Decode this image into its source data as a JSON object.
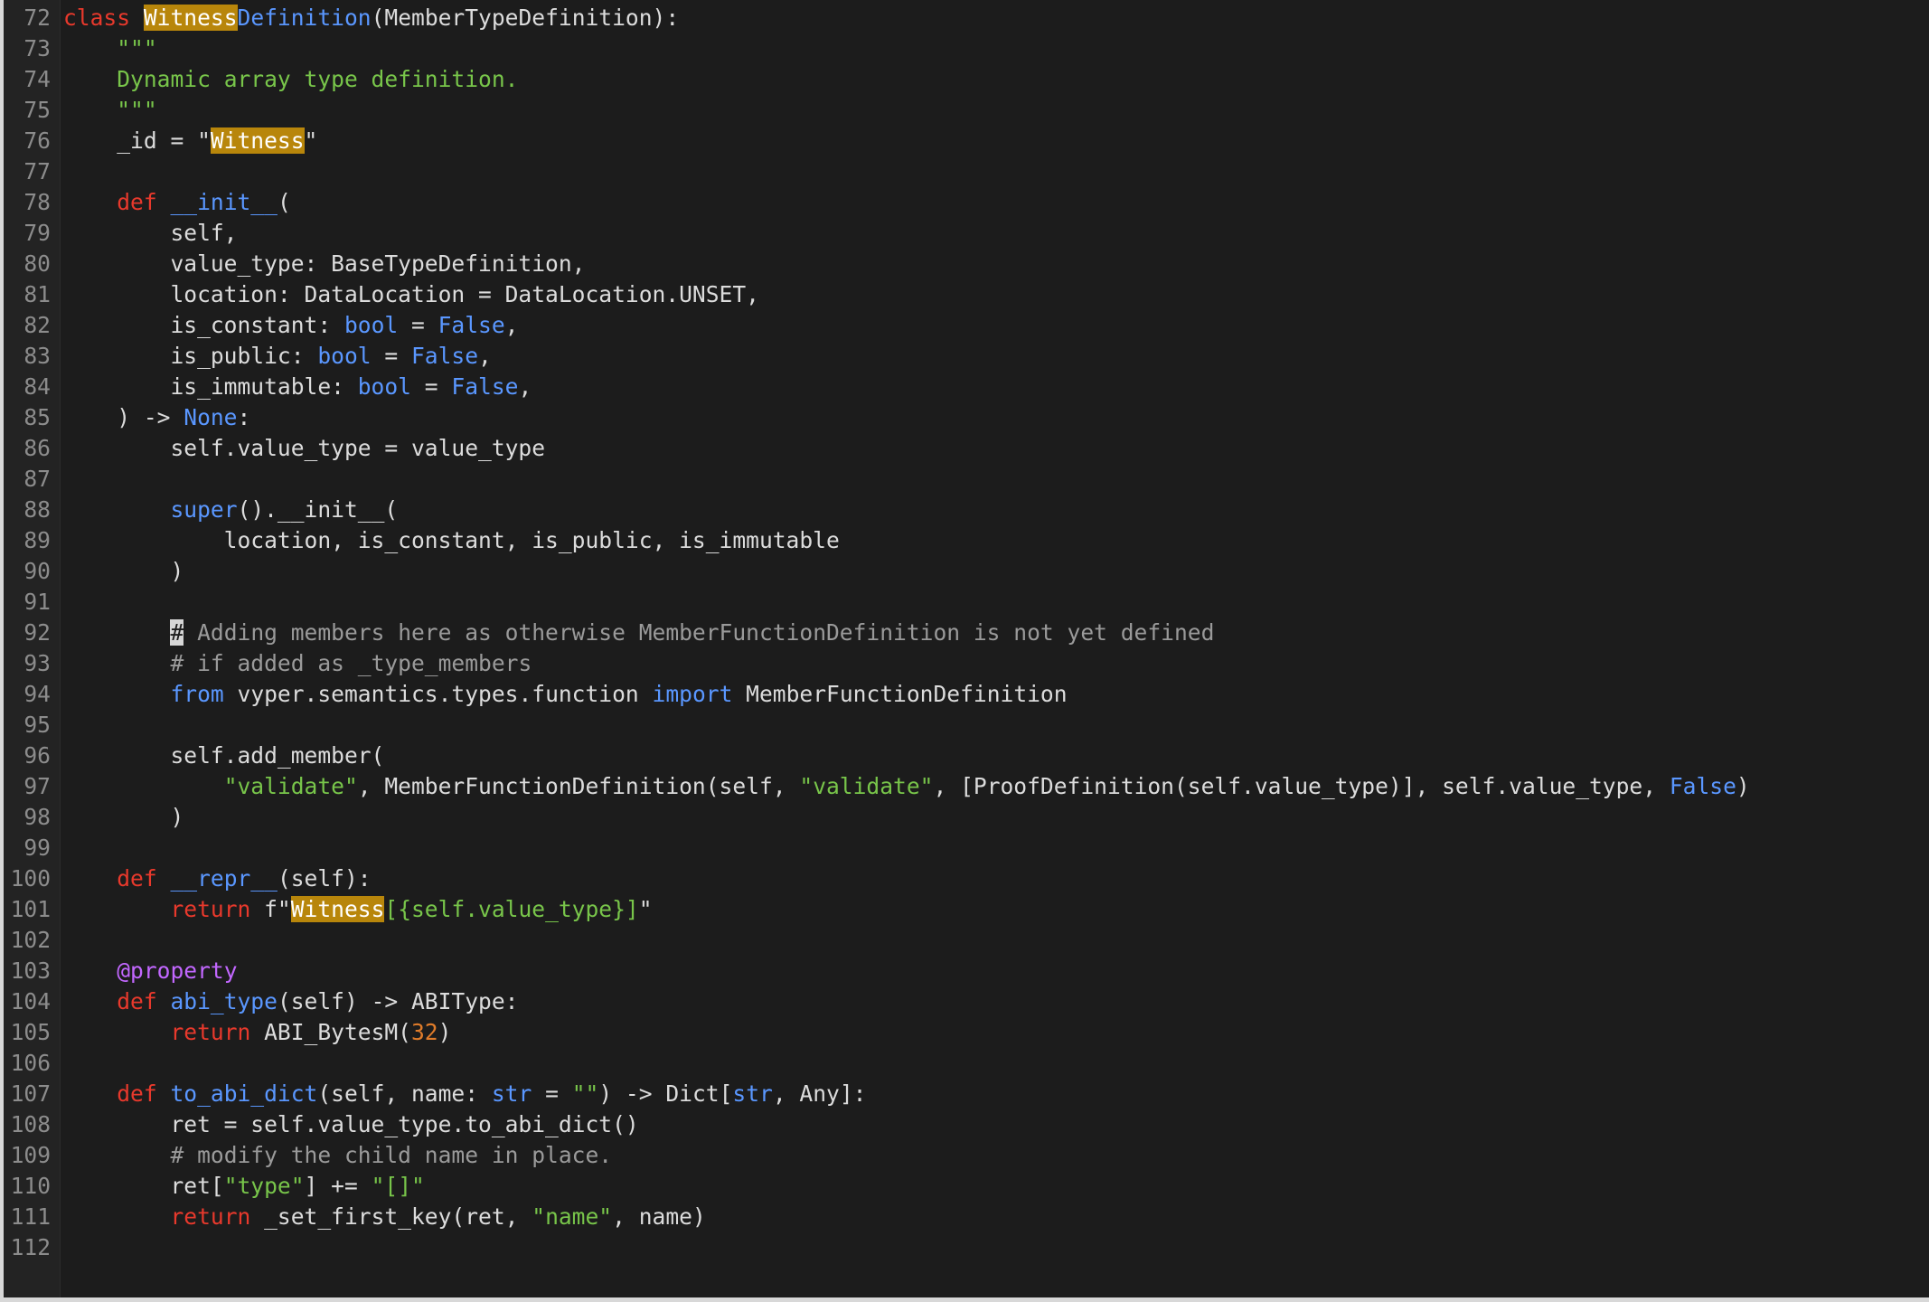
{
  "editor": {
    "language": "python",
    "highlight_term": "Witness",
    "lines": [
      {
        "n": "72",
        "tokens": [
          {
            "t": "class",
            "c": "kw"
          },
          {
            "t": " "
          },
          {
            "t": "Witness",
            "c": "hl"
          },
          {
            "t": "Definition",
            "c": "bl"
          },
          {
            "t": "(MemberTypeDefinition):"
          }
        ]
      },
      {
        "n": "73",
        "tokens": [
          {
            "t": "    "
          },
          {
            "t": "\"\"\"",
            "c": "str"
          }
        ]
      },
      {
        "n": "74",
        "tokens": [
          {
            "t": "    "
          },
          {
            "t": "Dynamic array type definition.",
            "c": "str"
          }
        ]
      },
      {
        "n": "75",
        "tokens": [
          {
            "t": "    "
          },
          {
            "t": "\"\"\"",
            "c": "str"
          }
        ]
      },
      {
        "n": "76",
        "tokens": [
          {
            "t": "    _id = \""
          },
          {
            "t": "Witness",
            "c": "hl"
          },
          {
            "t": "\""
          }
        ]
      },
      {
        "n": "77",
        "tokens": []
      },
      {
        "n": "78",
        "tokens": [
          {
            "t": "    "
          },
          {
            "t": "def",
            "c": "kw"
          },
          {
            "t": " "
          },
          {
            "t": "__init__",
            "c": "bl"
          },
          {
            "t": "("
          }
        ]
      },
      {
        "n": "79",
        "tokens": [
          {
            "t": "        self,"
          }
        ]
      },
      {
        "n": "80",
        "tokens": [
          {
            "t": "        value_type: BaseTypeDefinition,"
          }
        ]
      },
      {
        "n": "81",
        "tokens": [
          {
            "t": "        location: DataLocation = DataLocation.UNSET,"
          }
        ]
      },
      {
        "n": "82",
        "tokens": [
          {
            "t": "        is_constant: "
          },
          {
            "t": "bool",
            "c": "bl"
          },
          {
            "t": " = "
          },
          {
            "t": "False",
            "c": "bl"
          },
          {
            "t": ","
          }
        ]
      },
      {
        "n": "83",
        "tokens": [
          {
            "t": "        is_public: "
          },
          {
            "t": "bool",
            "c": "bl"
          },
          {
            "t": " = "
          },
          {
            "t": "False",
            "c": "bl"
          },
          {
            "t": ","
          }
        ]
      },
      {
        "n": "84",
        "tokens": [
          {
            "t": "        is_immutable: "
          },
          {
            "t": "bool",
            "c": "bl"
          },
          {
            "t": " = "
          },
          {
            "t": "False",
            "c": "bl"
          },
          {
            "t": ","
          }
        ]
      },
      {
        "n": "85",
        "tokens": [
          {
            "t": "    ) -> "
          },
          {
            "t": "None",
            "c": "bl"
          },
          {
            "t": ":"
          }
        ]
      },
      {
        "n": "86",
        "tokens": [
          {
            "t": "        self.value_type = value_type"
          }
        ]
      },
      {
        "n": "87",
        "tokens": []
      },
      {
        "n": "88",
        "tokens": [
          {
            "t": "        "
          },
          {
            "t": "super",
            "c": "bl"
          },
          {
            "t": "().__init__("
          }
        ]
      },
      {
        "n": "89",
        "tokens": [
          {
            "t": "            location, is_constant, is_public, is_immutable"
          }
        ]
      },
      {
        "n": "90",
        "tokens": [
          {
            "t": "        )"
          }
        ]
      },
      {
        "n": "91",
        "tokens": []
      },
      {
        "n": "92",
        "tokens": [
          {
            "t": "        "
          },
          {
            "t": "#",
            "c": "cursor"
          },
          {
            "t": " Adding members here as otherwise MemberFunctionDefinition is not yet defined",
            "c": "cm"
          }
        ]
      },
      {
        "n": "93",
        "tokens": [
          {
            "t": "        "
          },
          {
            "t": "# if added as _type_members",
            "c": "cm"
          }
        ]
      },
      {
        "n": "94",
        "tokens": [
          {
            "t": "        "
          },
          {
            "t": "from",
            "c": "bl"
          },
          {
            "t": " vyper.semantics.types.function "
          },
          {
            "t": "import",
            "c": "bl"
          },
          {
            "t": " MemberFunctionDefinition"
          }
        ]
      },
      {
        "n": "95",
        "tokens": []
      },
      {
        "n": "96",
        "tokens": [
          {
            "t": "        self.add_member("
          }
        ]
      },
      {
        "n": "97",
        "tokens": [
          {
            "t": "            "
          },
          {
            "t": "\"validate\"",
            "c": "str"
          },
          {
            "t": ", MemberFunctionDefinition(self, "
          },
          {
            "t": "\"validate\"",
            "c": "str"
          },
          {
            "t": ", [ProofDefinition(self.value_type)], self.value_type, "
          },
          {
            "t": "False",
            "c": "bl"
          },
          {
            "t": ")"
          }
        ]
      },
      {
        "n": "98",
        "tokens": [
          {
            "t": "        )"
          }
        ]
      },
      {
        "n": "99",
        "tokens": []
      },
      {
        "n": "100",
        "tokens": [
          {
            "t": "    "
          },
          {
            "t": "def",
            "c": "kw"
          },
          {
            "t": " "
          },
          {
            "t": "__repr__",
            "c": "bl"
          },
          {
            "t": "(self):"
          }
        ]
      },
      {
        "n": "101",
        "tokens": [
          {
            "t": "        "
          },
          {
            "t": "return",
            "c": "kw"
          },
          {
            "t": " f\""
          },
          {
            "t": "Witness",
            "c": "hl"
          },
          {
            "t": "[{self.value_type}]",
            "c": "str"
          },
          {
            "t": "\""
          }
        ]
      },
      {
        "n": "102",
        "tokens": []
      },
      {
        "n": "103",
        "tokens": [
          {
            "t": "    "
          },
          {
            "t": "@property",
            "c": "dec"
          }
        ]
      },
      {
        "n": "104",
        "tokens": [
          {
            "t": "    "
          },
          {
            "t": "def",
            "c": "kw"
          },
          {
            "t": " "
          },
          {
            "t": "abi_type",
            "c": "bl"
          },
          {
            "t": "(self) -> ABIType:"
          }
        ]
      },
      {
        "n": "105",
        "tokens": [
          {
            "t": "        "
          },
          {
            "t": "return",
            "c": "kw"
          },
          {
            "t": " ABI_BytesM("
          },
          {
            "t": "32",
            "c": "num"
          },
          {
            "t": ")"
          }
        ]
      },
      {
        "n": "106",
        "tokens": []
      },
      {
        "n": "107",
        "tokens": [
          {
            "t": "    "
          },
          {
            "t": "def",
            "c": "kw"
          },
          {
            "t": " "
          },
          {
            "t": "to_abi_dict",
            "c": "bl"
          },
          {
            "t": "(self, name: "
          },
          {
            "t": "str",
            "c": "bl"
          },
          {
            "t": " = "
          },
          {
            "t": "\"\"",
            "c": "str"
          },
          {
            "t": ") -> Dict["
          },
          {
            "t": "str",
            "c": "bl"
          },
          {
            "t": ", Any]:"
          }
        ]
      },
      {
        "n": "108",
        "tokens": [
          {
            "t": "        ret = self.value_type.to_abi_dict()"
          }
        ]
      },
      {
        "n": "109",
        "tokens": [
          {
            "t": "        "
          },
          {
            "t": "# modify the child name in place.",
            "c": "cm"
          }
        ]
      },
      {
        "n": "110",
        "tokens": [
          {
            "t": "        ret["
          },
          {
            "t": "\"type\"",
            "c": "str"
          },
          {
            "t": "] += "
          },
          {
            "t": "\"[]\"",
            "c": "str"
          }
        ]
      },
      {
        "n": "111",
        "tokens": [
          {
            "t": "        "
          },
          {
            "t": "return",
            "c": "kw"
          },
          {
            "t": " _set_first_key(ret, "
          },
          {
            "t": "\"name\"",
            "c": "str"
          },
          {
            "t": ", name)"
          }
        ]
      },
      {
        "n": "112",
        "tokens": []
      }
    ]
  }
}
